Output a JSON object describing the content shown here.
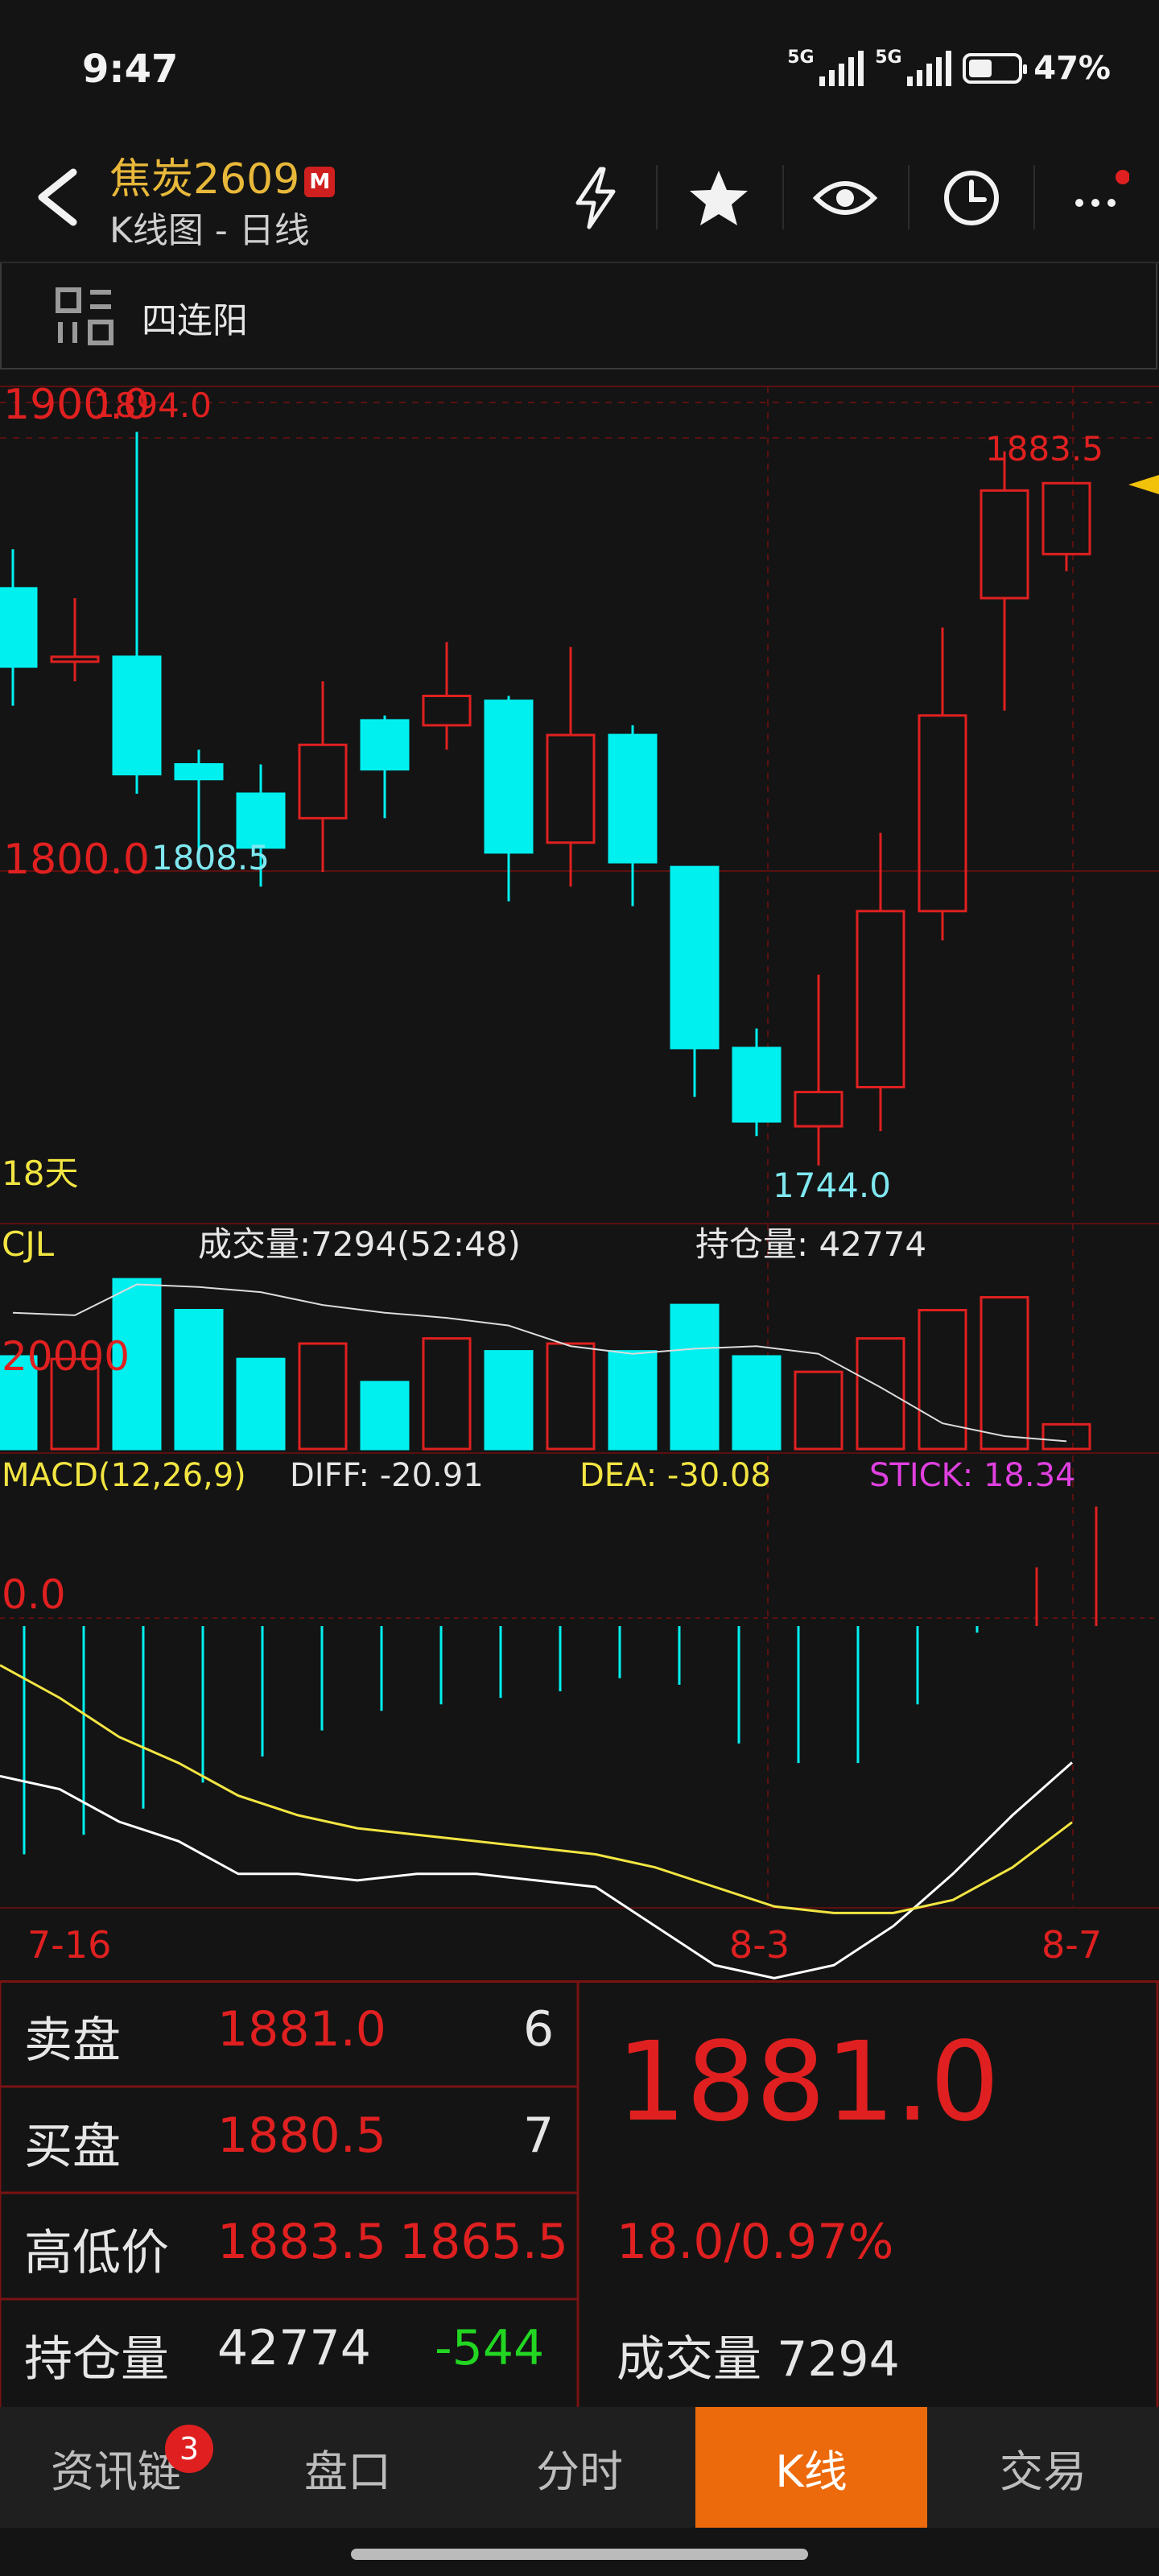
{
  "status_bar": {
    "time": "9:47",
    "signal1": "5G",
    "signal2": "5G",
    "battery": "47%",
    "battery_level": 0.47
  },
  "header": {
    "title": "焦炭2609",
    "badge": "M",
    "subtitle": "K线图 - 日线"
  },
  "pattern": {
    "label": "四连阳"
  },
  "chart_data": [
    {
      "type": "candlestick",
      "price_labels": {
        "top": "1900.0",
        "mid": "1800.0"
      },
      "ylim": [
        1740,
        1900
      ],
      "annotations": {
        "high": "1894.0",
        "low_left": "1808.5",
        "low": "1744.0",
        "recent_high": "1883.5"
      },
      "period_label": "18天",
      "candles": [
        {
          "open": 1862,
          "close": 1846,
          "high": 1870,
          "low": 1838
        },
        {
          "open": 1847,
          "close": 1848,
          "high": 1860,
          "low": 1843
        },
        {
          "open": 1848,
          "close": 1824,
          "high": 1894,
          "low": 1820
        },
        {
          "open": 1826,
          "close": 1823,
          "high": 1829,
          "low": 1808.5
        },
        {
          "open": 1820,
          "close": 1809,
          "high": 1826,
          "low": 1801
        },
        {
          "open": 1815,
          "close": 1830,
          "high": 1843,
          "low": 1804
        },
        {
          "open": 1835,
          "close": 1825,
          "high": 1836,
          "low": 1815
        },
        {
          "open": 1834,
          "close": 1840,
          "high": 1851,
          "low": 1829
        },
        {
          "open": 1839,
          "close": 1808,
          "high": 1840,
          "low": 1798
        },
        {
          "open": 1810,
          "close": 1832,
          "high": 1850,
          "low": 1801
        },
        {
          "open": 1832,
          "close": 1806,
          "high": 1834,
          "low": 1797
        },
        {
          "open": 1805,
          "close": 1768,
          "high": 1805,
          "low": 1758
        },
        {
          "open": 1768,
          "close": 1753,
          "high": 1772,
          "low": 1750
        },
        {
          "open": 1752,
          "close": 1759,
          "high": 1783,
          "low": 1744
        },
        {
          "open": 1760,
          "close": 1796,
          "high": 1812,
          "low": 1751
        },
        {
          "open": 1796,
          "close": 1836,
          "high": 1854,
          "low": 1790
        },
        {
          "open": 1860,
          "close": 1882,
          "high": 1890,
          "low": 1837
        },
        {
          "open": 1869,
          "close": 1883.5,
          "high": 1883.5,
          "low": 1865.5
        }
      ],
      "up_color": "#e02020",
      "down_color": "#00f0f0"
    },
    {
      "type": "bar",
      "name": "CJL",
      "title": "成交量:7294(52:48)",
      "right_label": "持仓量: 42774",
      "axis_label": "20000",
      "ylim": [
        0,
        36000
      ],
      "values": [
        18000,
        17500,
        33000,
        27000,
        17500,
        20500,
        13000,
        21500,
        19000,
        20500,
        19000,
        28000,
        18000,
        15000,
        21500,
        27000,
        29500,
        4800
      ],
      "directions": [
        "down",
        "up",
        "down",
        "down",
        "down",
        "up",
        "down",
        "up",
        "down",
        "up",
        "down",
        "down",
        "down",
        "up",
        "up",
        "up",
        "up",
        "up"
      ],
      "open_interest_line": [
        26500,
        26000,
        32000,
        31500,
        30500,
        28000,
        26500,
        25500,
        24000,
        20000,
        18500,
        19500,
        20000,
        18500,
        12000,
        5000,
        2500,
        1500
      ]
    },
    {
      "type": "bar",
      "name": "MACD(12,26,9)",
      "diff_label": "DIFF: -20.91",
      "dea_label": "DEA: -30.08",
      "stick_label": "STICK: 18.34",
      "axis_label": "0.0",
      "ylim": [
        -55,
        25
      ],
      "stick": [
        -35,
        -32,
        -28,
        -24,
        -20,
        -16,
        -13,
        -12,
        -11,
        -10,
        -8,
        -9,
        -18,
        -21,
        -21,
        -12,
        -1,
        9,
        18.34
      ],
      "diff": [
        -23,
        -25,
        -30,
        -33,
        -38,
        -38,
        -39,
        -38,
        -38,
        -39,
        -40,
        -46,
        -52,
        -54,
        -52,
        -46,
        -38,
        -29,
        -20.91
      ],
      "dea": [
        -6,
        -11,
        -17,
        -21,
        -26,
        -29,
        -31,
        -32,
        -33,
        -34,
        -35,
        -37,
        -40,
        -43,
        -44,
        -44,
        -42,
        -37,
        -30.08
      ]
    }
  ],
  "date_labels": [
    "7-16",
    "8-3",
    "8-7"
  ],
  "info": {
    "sell_label": "卖盘",
    "sell_price": "1881.0",
    "sell_qty": "6",
    "buy_label": "买盘",
    "buy_price": "1880.5",
    "buy_qty": "7",
    "hl_label": "高低价",
    "high": "1883.5",
    "low": "1865.5",
    "oi_label": "持仓量",
    "oi": "42774",
    "oi_change": "-544",
    "last_price": "1881.0",
    "change": "18.0/0.97%",
    "volume_label": "成交量",
    "volume": "7294"
  },
  "tabs": [
    {
      "label": "资讯链",
      "badge": "3"
    },
    {
      "label": "盘口"
    },
    {
      "label": "分时"
    },
    {
      "label": "K线",
      "active": true
    },
    {
      "label": "交易"
    }
  ],
  "colors": {
    "red": "#e02020",
    "cyan": "#00f0f0",
    "yellow": "#f2e542",
    "magenta": "#e040e0",
    "orange": "#ec6a0c",
    "gold": "#e8b83a",
    "green": "#22d622"
  }
}
